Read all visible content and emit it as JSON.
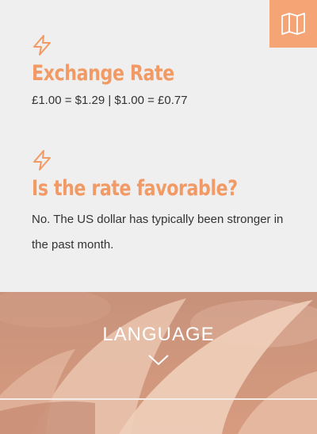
{
  "icons": {
    "map": "map-icon",
    "bolt": "lightning-bolt-icon",
    "chevron": "chevron-down-icon"
  },
  "colors": {
    "accent": "#f29a66",
    "map_button": "#f4a475",
    "background": "#f0efef",
    "body_text": "#333333"
  },
  "exchange": {
    "title": "Exchange Rate",
    "value": "£1.00 = $1.29 | $1.00 = £0.77"
  },
  "favorable": {
    "title": "Is the rate favorable?",
    "text": "No. The US dollar has typically been stronger in the past month."
  },
  "language": {
    "label": "LANGUAGE"
  }
}
